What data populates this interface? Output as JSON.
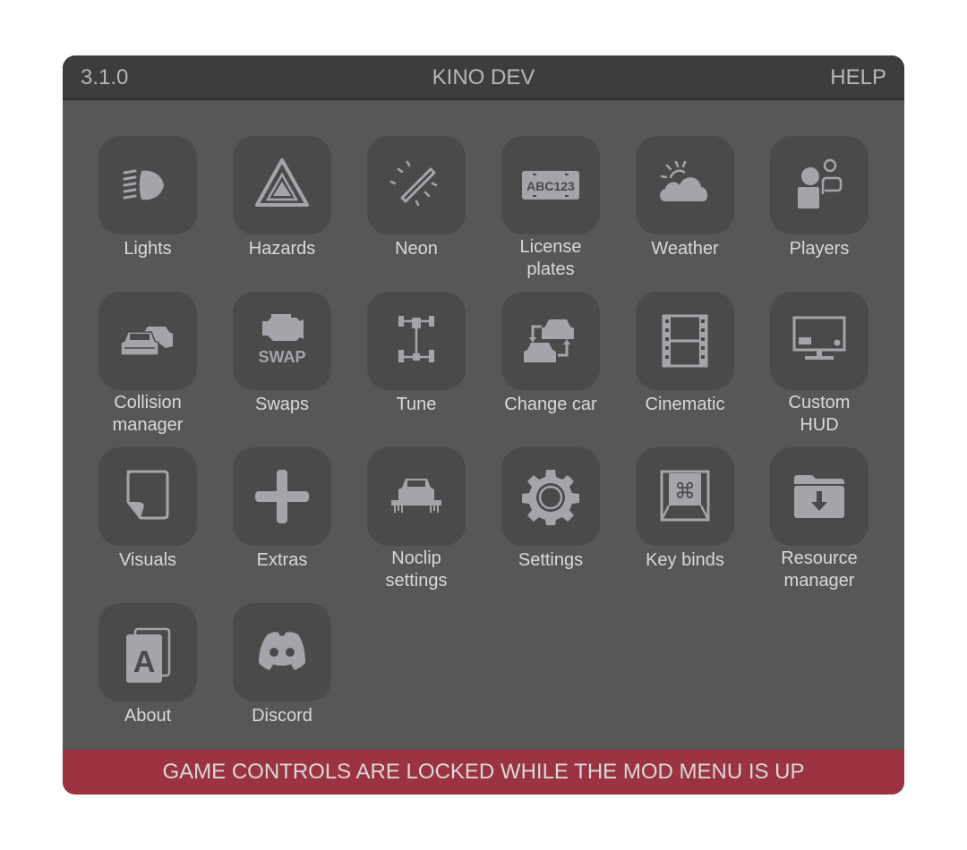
{
  "header": {
    "version": "3.1.0",
    "title": "KINO DEV",
    "help_label": "HELP"
  },
  "menu": {
    "items": [
      {
        "id": "lights",
        "label": "Lights",
        "icon": "headlight-icon"
      },
      {
        "id": "hazards",
        "label": "Hazards",
        "icon": "hazard-triangle-icon"
      },
      {
        "id": "neon",
        "label": "Neon",
        "icon": "neon-tube-icon"
      },
      {
        "id": "license-plates",
        "label": "License\nplates",
        "icon": "license-plate-icon",
        "icon_text": "ABC123"
      },
      {
        "id": "weather",
        "label": "Weather",
        "icon": "sun-cloud-icon"
      },
      {
        "id": "players",
        "label": "Players",
        "icon": "users-icon"
      },
      {
        "id": "collision-manager",
        "label": "Collision\nmanager",
        "icon": "two-cars-icon"
      },
      {
        "id": "swaps",
        "label": "Swaps",
        "icon": "engine-swap-icon",
        "icon_text": "SWAP"
      },
      {
        "id": "tune",
        "label": "Tune",
        "icon": "drivetrain-icon"
      },
      {
        "id": "change-car",
        "label": "Change car",
        "icon": "swap-cars-icon"
      },
      {
        "id": "cinematic",
        "label": "Cinematic",
        "icon": "film-strip-icon"
      },
      {
        "id": "custom-hud",
        "label": "Custom\nHUD",
        "icon": "monitor-icon"
      },
      {
        "id": "visuals",
        "label": "Visuals",
        "icon": "page-curl-icon"
      },
      {
        "id": "extras",
        "label": "Extras",
        "icon": "plus-icon"
      },
      {
        "id": "noclip-settings",
        "label": "Noclip\nsettings",
        "icon": "floating-car-icon"
      },
      {
        "id": "settings",
        "label": "Settings",
        "icon": "gear-icon"
      },
      {
        "id": "key-binds",
        "label": "Key binds",
        "icon": "command-key-icon",
        "icon_text": "⌘"
      },
      {
        "id": "resource-manager",
        "label": "Resource\nmanager",
        "icon": "folder-download-icon"
      },
      {
        "id": "about",
        "label": "About",
        "icon": "about-card-icon",
        "icon_text": "A"
      },
      {
        "id": "discord",
        "label": "Discord",
        "icon": "discord-icon"
      }
    ]
  },
  "footer": {
    "message": "GAME CONTROLS ARE LOCKED WHILE THE MOD MENU IS UP"
  },
  "colors": {
    "header_bg": "#3d3d3d",
    "body_bg": "#575757",
    "tile_bg": "#4a4a4a",
    "icon": "#a3a5aa",
    "text": "#d9d9d9",
    "footer_bg": "#9b3340"
  }
}
